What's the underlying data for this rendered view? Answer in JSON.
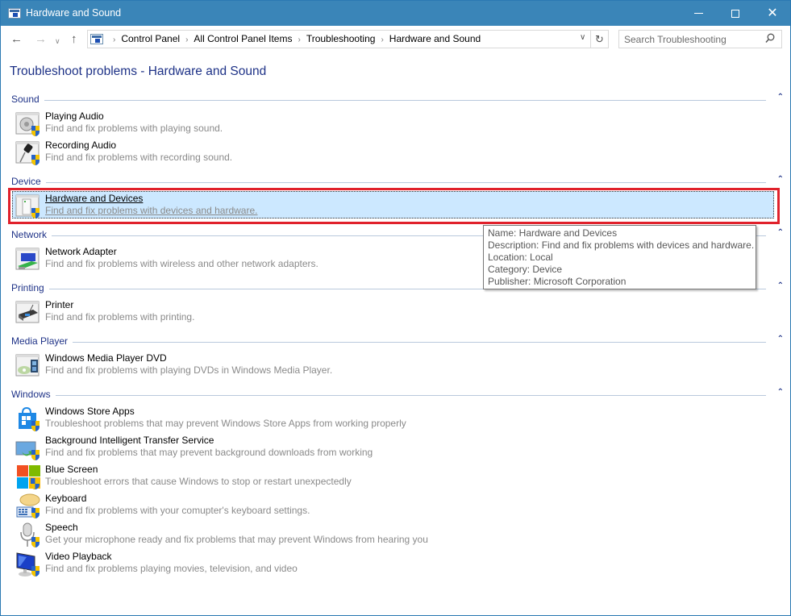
{
  "window": {
    "title": "Hardware and Sound",
    "controls": {
      "minimize": "minimize",
      "maximize": "maximize",
      "close": "close"
    }
  },
  "nav": {
    "back_icon": "←",
    "forward_icon": "→",
    "recent_icon": "⌄",
    "up_icon": "↑",
    "breadcrumbs": [
      "Control Panel",
      "All Control Panel Items",
      "Troubleshooting",
      "Hardware and Sound"
    ],
    "separator": "›",
    "dropdown_icon": "⌄",
    "refresh_icon": "↻",
    "search_placeholder": "Search Troubleshooting",
    "search_icon": "⚲"
  },
  "main": {
    "page_title": "Troubleshoot problems - Hardware and Sound",
    "groups": [
      {
        "label": "Sound",
        "items": [
          {
            "name": "Playing Audio",
            "desc": "Find and fix problems with playing sound.",
            "icon": "speaker-icon"
          },
          {
            "name": "Recording Audio",
            "desc": "Find and fix problems with recording sound.",
            "icon": "microphone-icon"
          }
        ]
      },
      {
        "label": "Device",
        "items": [
          {
            "name": "Hardware and Devices",
            "desc": "Find and fix problems with devices and hardware.",
            "icon": "hardware-icon",
            "selected": true
          }
        ]
      },
      {
        "label": "Network",
        "items": [
          {
            "name": "Network Adapter",
            "desc": "Find and fix problems with wireless and other network adapters.",
            "icon": "network-adapter-icon"
          }
        ]
      },
      {
        "label": "Printing",
        "items": [
          {
            "name": "Printer",
            "desc": "Find and fix problems with printing.",
            "icon": "printer-icon"
          }
        ]
      },
      {
        "label": "Media Player",
        "items": [
          {
            "name": "Windows Media Player DVD",
            "desc": "Find and fix problems with playing DVDs in Windows Media Player.",
            "icon": "dvd-icon"
          }
        ]
      },
      {
        "label": "Windows",
        "items": [
          {
            "name": "Windows Store Apps",
            "desc": "Troubleshoot problems that may prevent Windows Store Apps from working properly",
            "icon": "store-icon"
          },
          {
            "name": "Background Intelligent Transfer Service",
            "desc": "Find and fix problems that may prevent background downloads from working",
            "icon": "bits-icon"
          },
          {
            "name": "Blue Screen",
            "desc": "Troubleshoot errors that cause Windows to stop or restart unexpectedly",
            "icon": "windows-logo-icon"
          },
          {
            "name": "Keyboard",
            "desc": "Find and fix problems with your comupter's keyboard settings.",
            "icon": "keyboard-icon"
          },
          {
            "name": "Speech",
            "desc": "Get your microphone ready and fix problems that may prevent Windows from hearing you",
            "icon": "speech-mic-icon"
          },
          {
            "name": "Video Playback",
            "desc": "Find and fix problems playing movies, television, and video",
            "icon": "monitor-icon"
          }
        ]
      }
    ],
    "collapse_icon": "^"
  },
  "tooltip": {
    "lines": [
      "Name: Hardware and Devices",
      "Description: Find and fix problems with devices and hardware.",
      "Location: Local",
      "Category: Device",
      "Publisher: Microsoft Corporation"
    ]
  },
  "colors": {
    "titlebar": "#3a85b8",
    "group_header": "#1e3287",
    "selection_bg": "#cce8ff",
    "highlight_border": "#e0212b",
    "desc_text": "#8a8a8a"
  }
}
